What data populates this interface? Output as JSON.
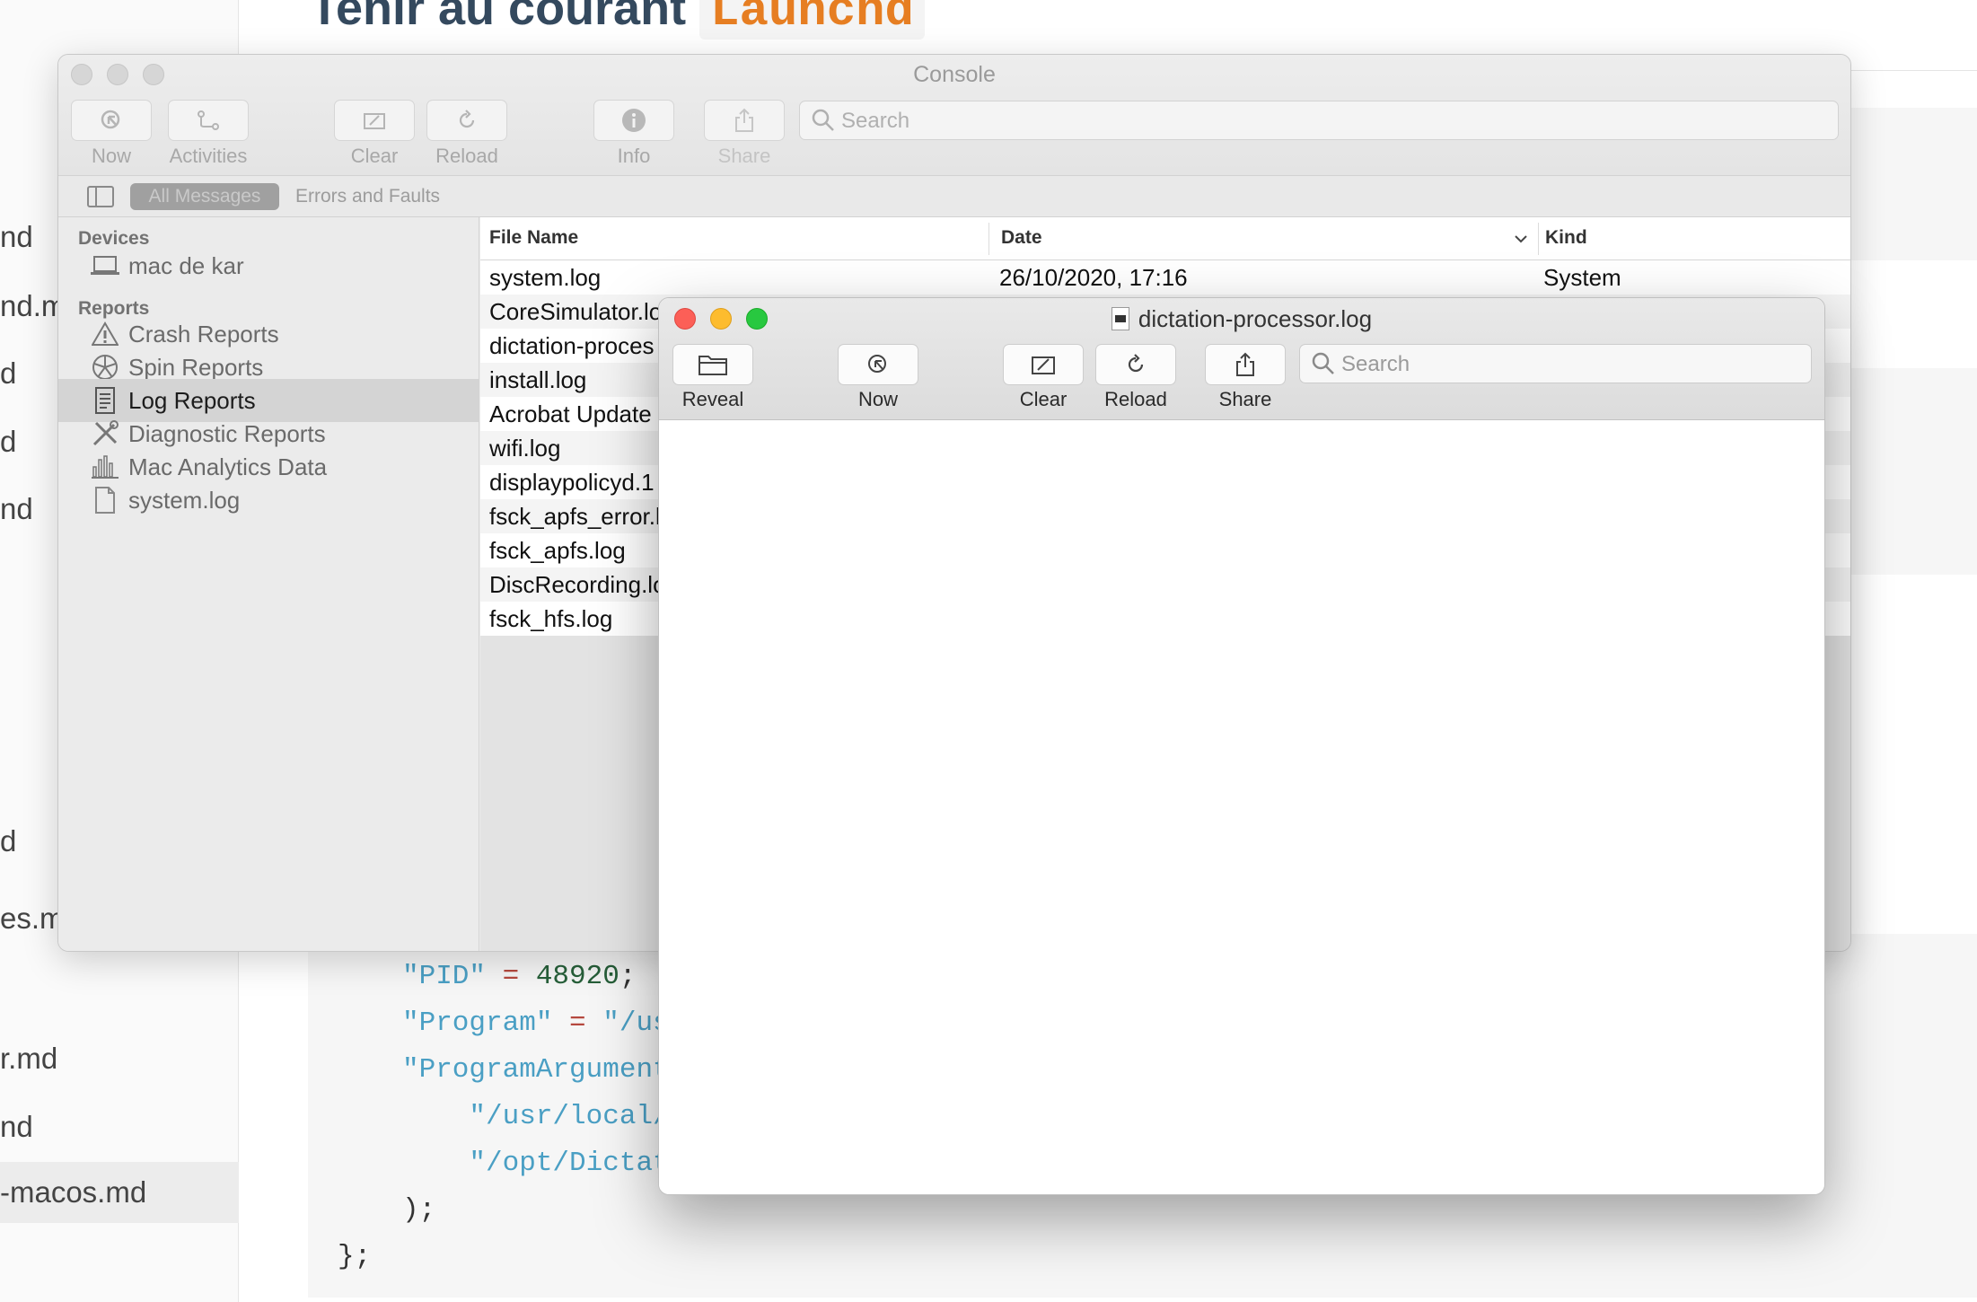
{
  "background": {
    "title_prefix": "Tenir au courant",
    "title_code": "Launchd",
    "sidebar_files": [
      "nd",
      "nd.m",
      "d",
      "d",
      "nd",
      "d",
      "es.md",
      "r.md",
      "nd",
      "-macos.md"
    ],
    "code_lines": [
      {
        "a": "\"PID\"",
        "b": " = ",
        "c": "48920",
        "d": ";"
      },
      {
        "a": "\"Program\"",
        "b": " = ",
        "c": "\"/us",
        "d": ""
      },
      {
        "a": "\"ProgramArgument",
        "b": "",
        "c": "",
        "d": ""
      },
      {
        "a": "    \"/usr/local/",
        "b": "",
        "c": "",
        "d": ""
      },
      {
        "a": "    \"/opt/Dictat",
        "b": "",
        "c": "",
        "d": ""
      },
      {
        "a": ");",
        "b": "",
        "c": "",
        "d": ""
      },
      {
        "a": "};",
        "b": "",
        "c": "",
        "d": ""
      }
    ]
  },
  "console": {
    "title": "Console",
    "toolbar": {
      "now": "Now",
      "activities": "Activities",
      "clear": "Clear",
      "reload": "Reload",
      "info": "Info",
      "share": "Share",
      "search_placeholder": "Search"
    },
    "filters": {
      "all": "All Messages",
      "errors": "Errors and Faults"
    },
    "sidebar": {
      "devices_header": "Devices",
      "device": "mac de kar",
      "reports_header": "Reports",
      "items": [
        {
          "label": "Crash Reports",
          "icon": "warning-icon"
        },
        {
          "label": "Spin Reports",
          "icon": "spin-icon"
        },
        {
          "label": "Log Reports",
          "icon": "log-icon",
          "selected": true
        },
        {
          "label": "Diagnostic Reports",
          "icon": "tools-icon"
        },
        {
          "label": "Mac Analytics Data",
          "icon": "chart-icon"
        },
        {
          "label": "system.log",
          "icon": "document-icon"
        }
      ]
    },
    "columns": {
      "file_name": "File Name",
      "date": "Date",
      "kind": "Kind"
    },
    "rows": [
      {
        "name": "system.log",
        "date": "26/10/2020, 17:16",
        "kind": "System"
      },
      {
        "name": "CoreSimulator.lo",
        "date": "",
        "kind": ""
      },
      {
        "name": "dictation-proces",
        "date": "",
        "kind": ""
      },
      {
        "name": "install.log",
        "date": "",
        "kind": ""
      },
      {
        "name": "Acrobat Update",
        "date": "",
        "kind": ""
      },
      {
        "name": "wifi.log",
        "date": "",
        "kind": ""
      },
      {
        "name": "displaypolicyd.1",
        "date": "",
        "kind": ""
      },
      {
        "name": "fsck_apfs_error.l",
        "date": "",
        "kind": ""
      },
      {
        "name": "fsck_apfs.log",
        "date": "",
        "kind": ""
      },
      {
        "name": "DiscRecording.lo",
        "date": "",
        "kind": ""
      },
      {
        "name": "fsck_hfs.log",
        "date": "",
        "kind": ""
      }
    ]
  },
  "log_window": {
    "title": "dictation-processor.log",
    "toolbar": {
      "reveal": "Reveal",
      "now": "Now",
      "clear": "Clear",
      "reload": "Reload",
      "share": "Share",
      "search_placeholder": "Search"
    }
  },
  "colors": {
    "close": "#fc5f57",
    "minimize": "#fdbc2e",
    "zoom": "#28c840",
    "accent_code": "#e67e22"
  }
}
